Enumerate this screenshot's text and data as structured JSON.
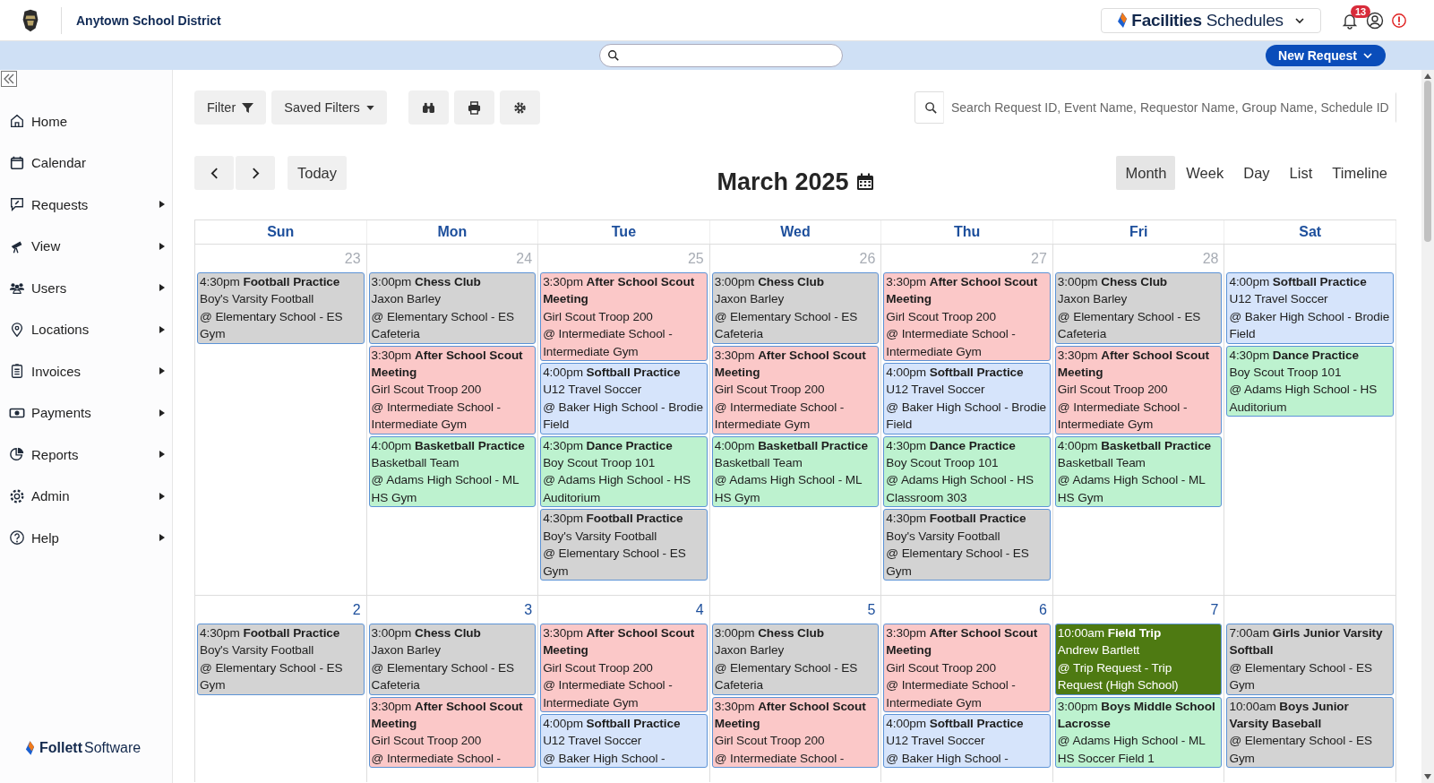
{
  "header": {
    "district": "Anytown School District",
    "product": {
      "brand": "Facilities",
      "name": "Schedules"
    },
    "notification_count": "13"
  },
  "action_bar": {
    "new_request": "New Request"
  },
  "sidebar": {
    "items": [
      {
        "label": "Home",
        "has_submenu": false
      },
      {
        "label": "Calendar",
        "has_submenu": false
      },
      {
        "label": "Requests",
        "has_submenu": true
      },
      {
        "label": "View",
        "has_submenu": true
      },
      {
        "label": "Users",
        "has_submenu": true
      },
      {
        "label": "Locations",
        "has_submenu": true
      },
      {
        "label": "Invoices",
        "has_submenu": true
      },
      {
        "label": "Payments",
        "has_submenu": true
      },
      {
        "label": "Reports",
        "has_submenu": true
      },
      {
        "label": "Admin",
        "has_submenu": true
      },
      {
        "label": "Help",
        "has_submenu": true
      }
    ],
    "footer": {
      "brand": "Follett",
      "name": "Software"
    }
  },
  "toolbar": {
    "filter": "Filter",
    "saved_filters": "Saved Filters",
    "search_placeholder": "Search Request ID, Event Name, Requestor Name, Group Name, Schedule ID"
  },
  "calendar": {
    "title": "March 2025",
    "today": "Today",
    "views": [
      {
        "label": "Month",
        "selected": true
      },
      {
        "label": "Week",
        "selected": false
      },
      {
        "label": "Day",
        "selected": false
      },
      {
        "label": "List",
        "selected": false
      },
      {
        "label": "Timeline",
        "selected": false
      }
    ],
    "weekdays": [
      "Sun",
      "Mon",
      "Tue",
      "Wed",
      "Thu",
      "Fri",
      "Sat"
    ],
    "weeks": [
      {
        "days": [
          {
            "date": "23",
            "other_month": true,
            "events": [
              {
                "time": "4:30pm",
                "title": "Football Practice",
                "group": "Boy's Varsity Football",
                "location": "@ Elementary School - ES Gym",
                "color": "#d3d3d3"
              }
            ]
          },
          {
            "date": "24",
            "other_month": true,
            "events": [
              {
                "time": "3:00pm",
                "title": "Chess Club",
                "group": "Jaxon Barley",
                "location": "@ Elementary School - ES Cafeteria",
                "color": "#d3d3d3"
              },
              {
                "time": "3:30pm",
                "title": "After School Scout Meeting",
                "group": "Girl Scout Troop 200",
                "location": "@ Intermediate School - Intermediate Gym",
                "color": "#fbc8c8"
              },
              {
                "time": "4:00pm",
                "title": "Basketball Practice",
                "group": "Basketball Team",
                "location": "@ Adams High School - ML HS Gym",
                "color": "#bdf2cf"
              }
            ]
          },
          {
            "date": "25",
            "other_month": true,
            "events": [
              {
                "time": "3:30pm",
                "title": "After School Scout Meeting",
                "group": "Girl Scout Troop 200",
                "location": "@ Intermediate School - Intermediate Gym",
                "color": "#fbc8c8"
              },
              {
                "time": "4:00pm",
                "title": "Softball Practice",
                "group": "U12 Travel Soccer",
                "location": "@ Baker High School - Brodie Field",
                "color": "#d6e4fb"
              },
              {
                "time": "4:30pm",
                "title": "Dance Practice",
                "group": "Boy Scout Troop 101",
                "location": "@ Adams High School - HS Auditorium",
                "color": "#bdf2cf"
              },
              {
                "time": "4:30pm",
                "title": "Football Practice",
                "group": "Boy's Varsity Football",
                "location": "@ Elementary School - ES Gym",
                "color": "#d3d3d3"
              }
            ]
          },
          {
            "date": "26",
            "other_month": true,
            "events": [
              {
                "time": "3:00pm",
                "title": "Chess Club",
                "group": "Jaxon Barley",
                "location": "@ Elementary School - ES Cafeteria",
                "color": "#d3d3d3"
              },
              {
                "time": "3:30pm",
                "title": "After School Scout Meeting",
                "group": "Girl Scout Troop 200",
                "location": "@ Intermediate School - Intermediate Gym",
                "color": "#fbc8c8"
              },
              {
                "time": "4:00pm",
                "title": "Basketball Practice",
                "group": "Basketball Team",
                "location": "@ Adams High School - ML HS Gym",
                "color": "#bdf2cf"
              }
            ]
          },
          {
            "date": "27",
            "other_month": true,
            "events": [
              {
                "time": "3:30pm",
                "title": "After School Scout Meeting",
                "group": "Girl Scout Troop 200",
                "location": "@ Intermediate School - Intermediate Gym",
                "color": "#fbc8c8"
              },
              {
                "time": "4:00pm",
                "title": "Softball Practice",
                "group": "U12 Travel Soccer",
                "location": "@ Baker High School - Brodie Field",
                "color": "#d6e4fb"
              },
              {
                "time": "4:30pm",
                "title": "Dance Practice",
                "group": "Boy Scout Troop 101",
                "location": "@ Adams High School - HS Classroom 303",
                "color": "#bdf2cf"
              },
              {
                "time": "4:30pm",
                "title": "Football Practice",
                "group": "Boy's Varsity Football",
                "location": "@ Elementary School - ES Gym",
                "color": "#d3d3d3"
              }
            ]
          },
          {
            "date": "28",
            "other_month": true,
            "events": [
              {
                "time": "3:00pm",
                "title": "Chess Club",
                "group": "Jaxon Barley",
                "location": "@ Elementary School - ES Cafeteria",
                "color": "#d3d3d3"
              },
              {
                "time": "3:30pm",
                "title": "After School Scout Meeting",
                "group": "Girl Scout Troop 200",
                "location": "@ Intermediate School - Intermediate Gym",
                "color": "#fbc8c8"
              },
              {
                "time": "4:00pm",
                "title": "Basketball Practice",
                "group": "Basketball Team",
                "location": "@ Adams High School - ML HS Gym",
                "color": "#bdf2cf"
              }
            ]
          },
          {
            "events": [
              {
                "time": "4:00pm",
                "title": "Softball Practice",
                "group": "U12 Travel Soccer",
                "location": "@ Baker High School - Brodie Field",
                "color": "#d6e4fb"
              },
              {
                "time": "4:30pm",
                "title": "Dance Practice",
                "group": "Boy Scout Troop 101",
                "location": "@ Adams High School - HS Auditorium",
                "color": "#bdf2cf"
              }
            ]
          }
        ]
      },
      {
        "days": [
          {
            "date": "2",
            "other_month": false,
            "events": [
              {
                "time": "4:30pm",
                "title": "Football Practice",
                "group": "Boy's Varsity Football",
                "location": "@ Elementary School - ES Gym",
                "color": "#d3d3d3"
              }
            ]
          },
          {
            "date": "3",
            "other_month": false,
            "events": [
              {
                "time": "3:00pm",
                "title": "Chess Club",
                "group": "Jaxon Barley",
                "location": "@ Elementary School - ES Cafeteria",
                "color": "#d3d3d3"
              },
              {
                "time": "3:30pm",
                "title": "After School Scout Meeting",
                "group": "Girl Scout Troop 200",
                "location": "@ Intermediate School -",
                "color": "#fbc8c8"
              }
            ]
          },
          {
            "date": "4",
            "other_month": false,
            "events": [
              {
                "time": "3:30pm",
                "title": "After School Scout Meeting",
                "group": "Girl Scout Troop 200",
                "location": "@ Intermediate School - Intermediate Gym",
                "color": "#fbc8c8"
              },
              {
                "time": "4:00pm",
                "title": "Softball Practice",
                "group": "U12 Travel Soccer",
                "location": "@ Baker High School -",
                "color": "#d6e4fb"
              }
            ]
          },
          {
            "date": "5",
            "other_month": false,
            "events": [
              {
                "time": "3:00pm",
                "title": "Chess Club",
                "group": "Jaxon Barley",
                "location": "@ Elementary School - ES Cafeteria",
                "color": "#d3d3d3"
              },
              {
                "time": "3:30pm",
                "title": "After School Scout Meeting",
                "group": "Girl Scout Troop 200",
                "location": "@ Intermediate School -",
                "color": "#fbc8c8"
              }
            ]
          },
          {
            "date": "6",
            "other_month": false,
            "events": [
              {
                "time": "3:30pm",
                "title": "After School Scout Meeting",
                "group": "Girl Scout Troop 200",
                "location": "@ Intermediate School - Intermediate Gym",
                "color": "#fbc8c8"
              },
              {
                "time": "4:00pm",
                "title": "Softball Practice",
                "group": "U12 Travel Soccer",
                "location": "@ Baker High School -",
                "color": "#d6e4fb"
              }
            ]
          },
          {
            "date": "7",
            "other_month": false,
            "events": [
              {
                "time": "10:00am",
                "title": "Field Trip",
                "group": "Andrew Bartlett",
                "location": "@ Trip Request - Trip Request (High School)",
                "color": "#4e7a12"
              },
              {
                "time": "3:00pm",
                "title": "Boys Middle School Lacrosse",
                "location": "@ Adams High School - ML HS Soccer Field 1",
                "color": "#bdf2cf"
              }
            ]
          },
          {
            "events": [
              {
                "time": "7:00am",
                "title": "Girls Junior Varsity Softball",
                "location": "@ Elementary School - ES Gym",
                "color": "#d3d3d3"
              },
              {
                "time": "10:00am",
                "title": "Boys Junior Varsity Baseball",
                "location": "@ Elementary School - ES Gym",
                "color": "#d3d3d3"
              }
            ]
          }
        ]
      }
    ]
  }
}
